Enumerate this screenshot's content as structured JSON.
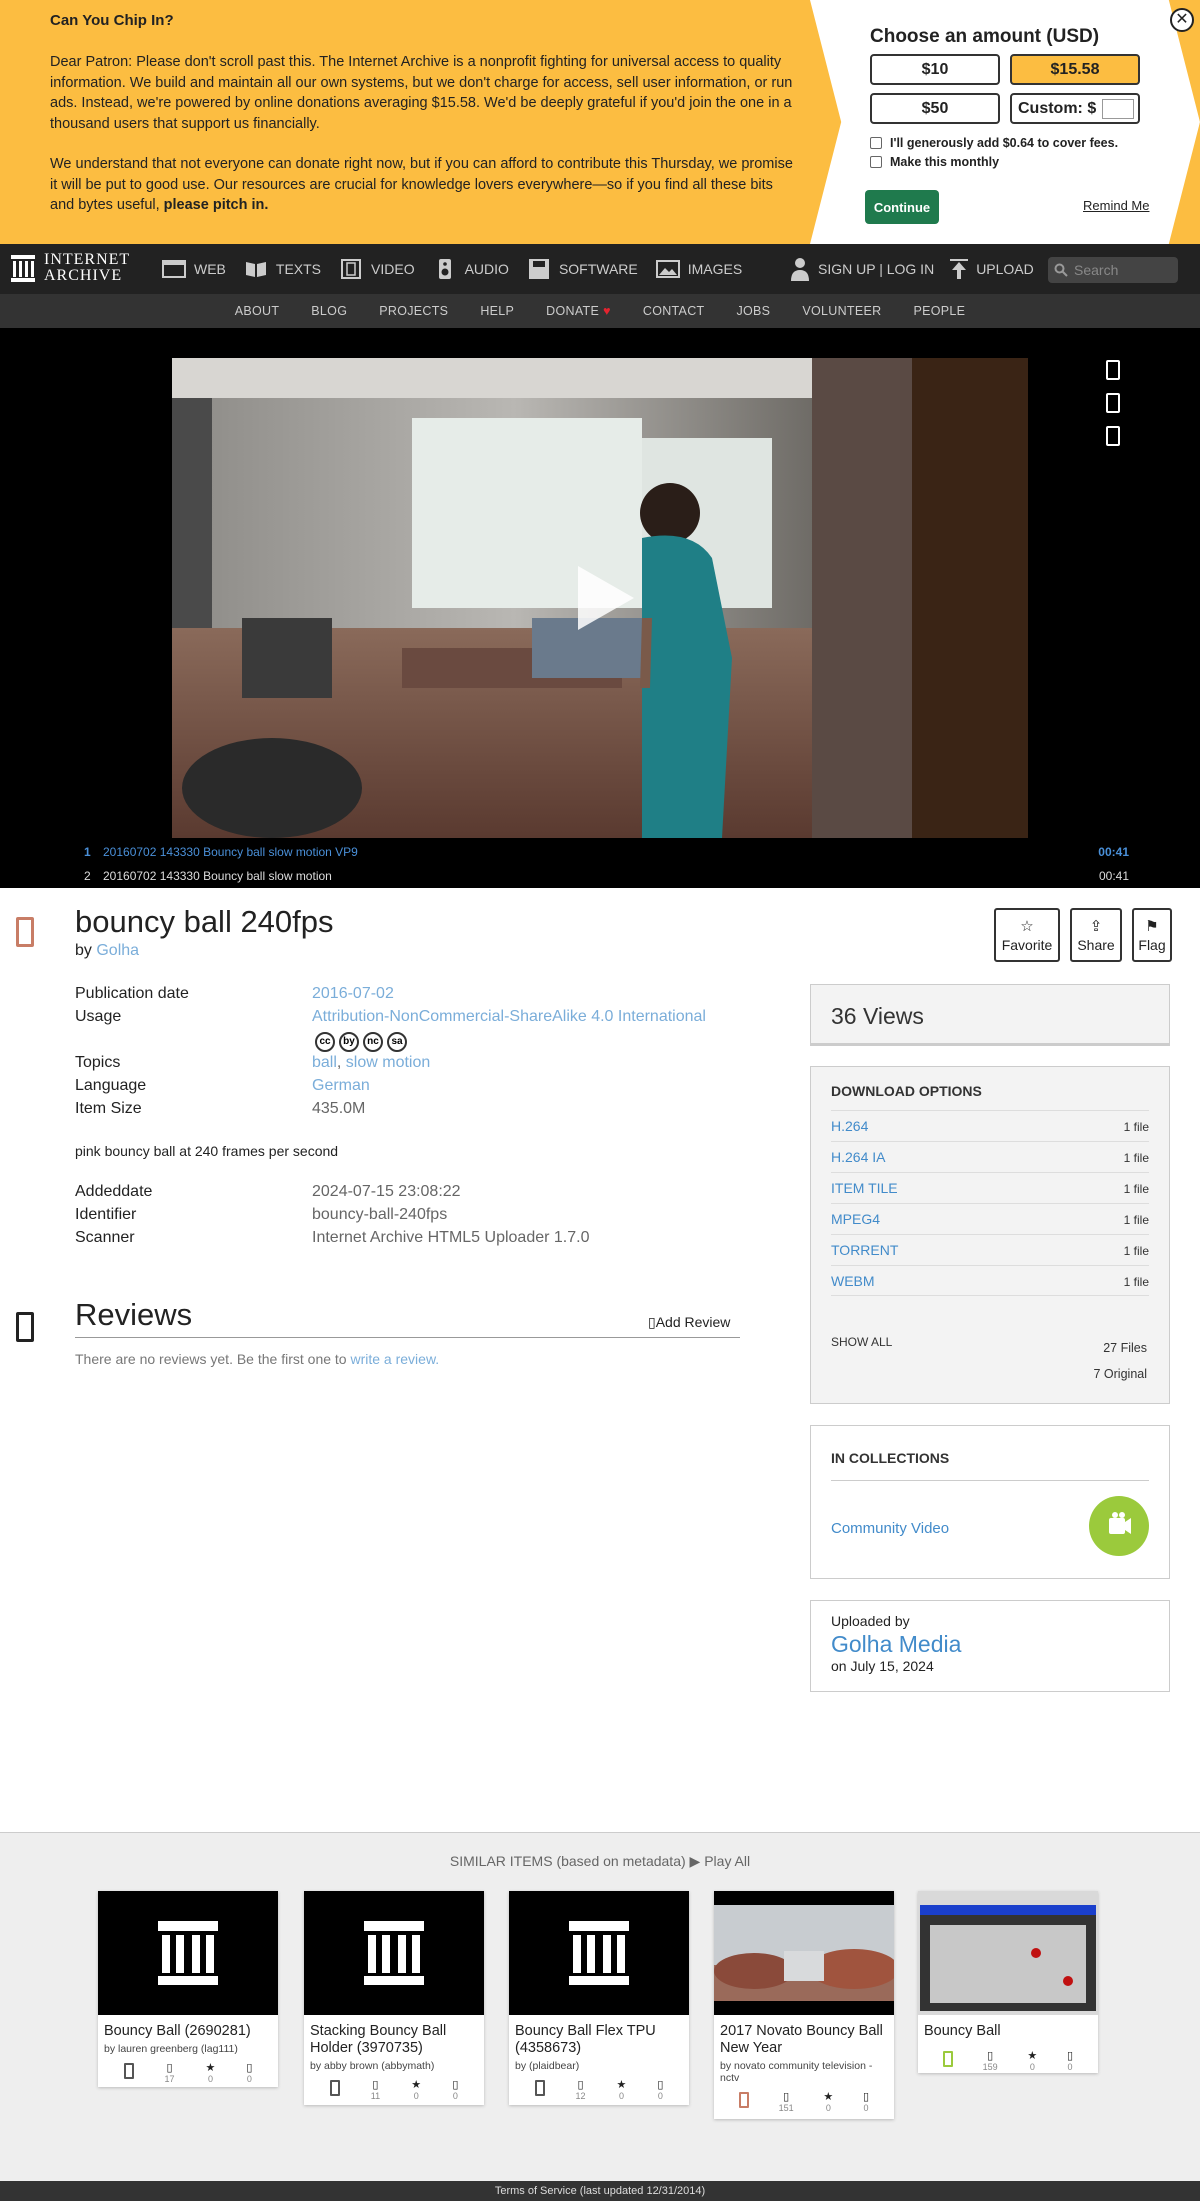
{
  "banner": {
    "title": "Can You Chip In?",
    "para1": "Dear Patron: Please don't scroll past this. The Internet Archive is a nonprofit fighting for universal access to quality information. We build and maintain all our own systems, but we don't charge for access, sell user information, or run ads. Instead, we're powered by online donations averaging $15.58. We'd be deeply grateful if you'd join the one in a thousand users that support us financially.",
    "para2_a": "We understand that not everyone can donate right now, but if you can afford to contribute this Thursday, we promise it will be put to good use. Our resources are crucial for knowledge lovers everywhere—so if you find all these bits and bytes useful, ",
    "para2_b": "please pitch in.",
    "choose_title": "Choose an amount (USD)",
    "amounts": [
      "$10",
      "$15.58",
      "$50",
      "Custom: $"
    ],
    "cover_fees": "I'll generously add $0.64 to cover fees.",
    "monthly": "Make this monthly",
    "continue": "Continue",
    "remind": "Remind Me",
    "close": "✕"
  },
  "nav": {
    "logo_line1": "INTERNET",
    "logo_line2": "ARCHIVE",
    "items": [
      "WEB",
      "TEXTS",
      "VIDEO",
      "AUDIO",
      "SOFTWARE",
      "IMAGES"
    ],
    "signup": "SIGN UP | LOG IN",
    "upload": "UPLOAD",
    "search_placeholder": "Search",
    "subnav": [
      "ABOUT",
      "BLOG",
      "PROJECTS",
      "HELP",
      "DONATE",
      "CONTACT",
      "JOBS",
      "VOLUNTEER",
      "PEOPLE"
    ]
  },
  "playlist": [
    {
      "n": "1",
      "title": "20160702 143330 Bouncy ball slow motion VP9",
      "dur": "00:41"
    },
    {
      "n": "2",
      "title": "20160702 143330 Bouncy ball slow motion",
      "dur": "00:41"
    }
  ],
  "item": {
    "title": "bouncy ball 240fps",
    "by_label": "by",
    "by": "Golha",
    "favorite": "Favorite",
    "share": "Share",
    "flag": "Flag",
    "meta": {
      "pubdate_label": "Publication date",
      "pubdate": "2016-07-02",
      "usage_label": "Usage",
      "usage": "Attribution-NonCommercial-ShareAlike 4.0 International",
      "topics_label": "Topics",
      "topic1": "ball",
      "topic2": "slow motion",
      "lang_label": "Language",
      "lang": "German",
      "size_label": "Item Size",
      "size": "435.0M",
      "desc": "pink bouncy ball at 240 frames per second",
      "added_label": "Addeddate",
      "added": "2024-07-15 23:08:22",
      "ident_label": "Identifier",
      "ident": "bouncy-ball-240fps",
      "scanner_label": "Scanner",
      "scanner": "Internet Archive HTML5 Uploader 1.7.0"
    },
    "cc_icons": [
      "cc",
      "by",
      "nc",
      "sa"
    ]
  },
  "reviews": {
    "title": "Reviews",
    "add": "Add Review",
    "none_a": "There are no reviews yet. Be the first one to ",
    "none_link": "write a review."
  },
  "sidebar": {
    "views": "36 Views",
    "dl_title": "DOWNLOAD OPTIONS",
    "downloads": [
      {
        "label": "H.264",
        "count": "1 file"
      },
      {
        "label": "H.264 IA",
        "count": "1 file"
      },
      {
        "label": "ITEM TILE",
        "count": "1 file"
      },
      {
        "label": "MPEG4",
        "count": "1 file"
      },
      {
        "label": "TORRENT",
        "count": "1 file"
      },
      {
        "label": "WEBM",
        "count": "1 file"
      }
    ],
    "show_all": "SHOW ALL",
    "files": "27 Files",
    "original": "7 Original",
    "coll_title": "IN COLLECTIONS",
    "collection": "Community Video",
    "uploaded_by": "Uploaded by",
    "uploader": "Golha Media",
    "uploaded_on": "on July 15, 2024"
  },
  "similar": {
    "head": "SIMILAR ITEMS (based on metadata)",
    "play_all": "Play All",
    "cards": [
      {
        "title": "Bouncy Ball (2690281)",
        "by": "by lauren greenberg (lag111)",
        "views": "17",
        "favs": "0",
        "reviews": "0"
      },
      {
        "title": "Stacking Bouncy Ball Holder (3970735)",
        "by": "by abby brown (abbymath)",
        "views": "11",
        "favs": "0",
        "reviews": "0"
      },
      {
        "title": "Bouncy Ball Flex TPU (4358673)",
        "by": "by (plaidbear)",
        "views": "12",
        "favs": "0",
        "reviews": "0"
      },
      {
        "title": "2017 Novato Bouncy Ball New Year",
        "by": "by novato community television - nctv",
        "views": "151",
        "favs": "0",
        "reviews": "0"
      },
      {
        "title": "Bouncy Ball",
        "by": "",
        "views": "159",
        "favs": "0",
        "reviews": "0"
      }
    ]
  },
  "footer": "Terms of Service (last updated 12/31/2014)"
}
